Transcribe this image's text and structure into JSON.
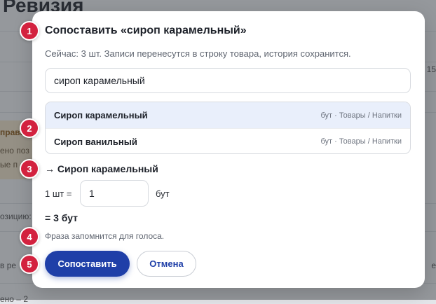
{
  "background": {
    "title": "Ревизия",
    "warn_line1": "правка",
    "warn_line2": "ено поз",
    "warn_line3": "ые п",
    "side_left_1": "озицию:",
    "side_left_2": "в ре",
    "side_left_3": "ено – 2",
    "side_right_1": "е 15",
    "side_right_2": "е"
  },
  "dialog": {
    "title": "Сопоставить «сироп карамельный»",
    "subtitle": "Сейчас: 3 шт. Записи перенесутся в строку товара, история сохранится.",
    "search_value": "сироп карамельный",
    "options": [
      {
        "name": "Сироп карамельный",
        "meta": "бут · Товары / Напитки"
      },
      {
        "name": "Сироп ванильный",
        "meta": "бут · Товары / Напитки"
      }
    ],
    "selected_label": "→ Сироп карамельный",
    "conversion_lhs": "1 шт =",
    "conversion_value": "1",
    "conversion_unit": "бут",
    "result": "= 3 бут",
    "hint": "Фраза запомнится для голоса.",
    "confirm_label": "Сопоставить",
    "cancel_label": "Отмена"
  },
  "badges": [
    "1",
    "2",
    "3",
    "4",
    "5"
  ],
  "colors": {
    "primary": "#1f3fa8",
    "badge": "#d3223f",
    "selected_row": "#e9effb"
  }
}
